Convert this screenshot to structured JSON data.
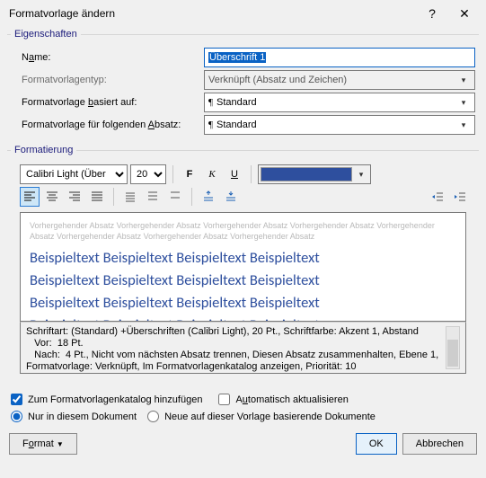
{
  "window": {
    "title": "Formatvorlage ändern",
    "help": "?",
    "close": "✕"
  },
  "properties": {
    "legend": "Eigenschaften",
    "name_label_pre": "N",
    "name_label_u": "a",
    "name_label_post": "me:",
    "name_value": "Überschrift 1",
    "type_label": "Formatvorlagentyp:",
    "type_value": "Verknüpft (Absatz und Zeichen)",
    "based_label_pre": "Formatvorlage ",
    "based_label_u": "b",
    "based_label_post": "asiert auf:",
    "based_value": "Standard",
    "next_label_pre": "Formatvorlage für folgenden ",
    "next_label_u": "A",
    "next_label_post": "bsatz:",
    "next_value": "Standard"
  },
  "formatting": {
    "legend": "Formatierung",
    "font": "Calibri Light (Über",
    "size": "20",
    "bold": "F",
    "italic": "K",
    "underline": "U"
  },
  "preview": {
    "ghost1": "Vorhergehender Absatz Vorhergehender Absatz Vorhergehender Absatz Vorhergehender Absatz Vorhergehender",
    "ghost2": "Absatz Vorhergehender Absatz Vorhergehender Absatz Vorhergehender Absatz",
    "sample": "Beispieltext Beispieltext Beispieltext Beispieltext"
  },
  "description": {
    "line1": "Schriftart: (Standard) +Überschriften (Calibri Light), 20 Pt., Schriftfarbe: Akzent 1, Abstand",
    "line2": "   Vor:  18 Pt.",
    "line3": "   Nach:  4 Pt., Nicht vom nächsten Absatz trennen, Diesen Absatz zusammenhalten, Ebene 1,",
    "line4": "Formatvorlage: Verknüpft, Im Formatvorlagenkatalog anzeigen, Priorität: 10"
  },
  "options": {
    "add_catalog": "Zum Formatvorlagenkatalog hinzufügen",
    "auto_update_u": "u",
    "auto_update_pre": "A",
    "auto_update_post": "tomatisch aktualisieren",
    "only_doc": "Nur in diesem Dokument",
    "new_based": "Neue auf dieser Vorlage basierende Dokumente"
  },
  "footer": {
    "format_pre": "F",
    "format_u": "o",
    "format_post": "rmat",
    "ok": "OK",
    "cancel": "Abbrechen"
  }
}
